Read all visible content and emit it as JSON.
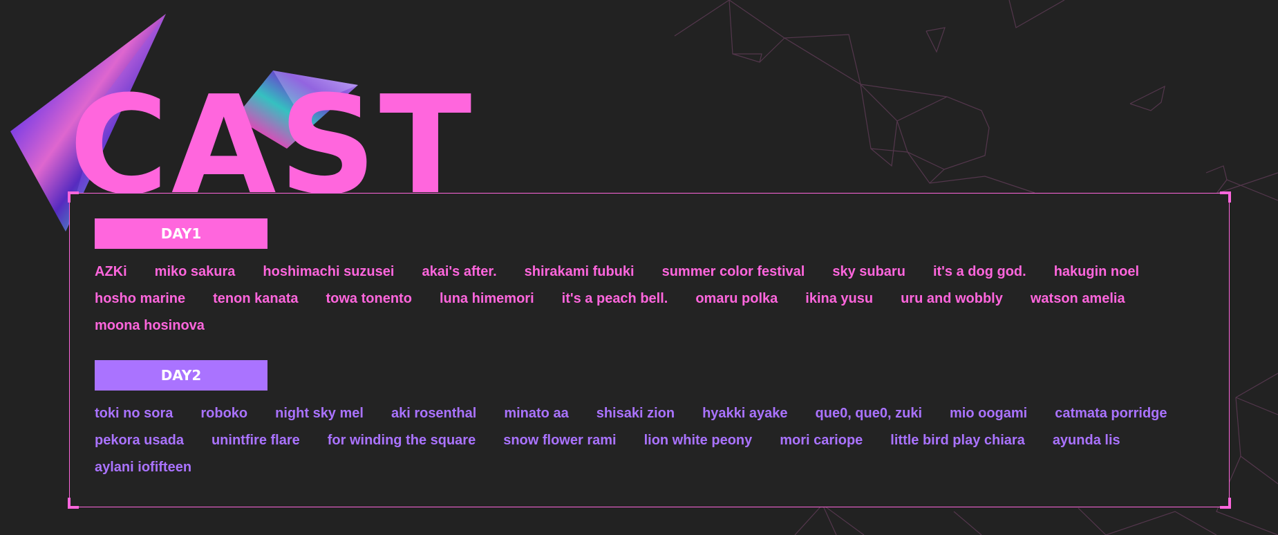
{
  "title": "CAST",
  "colors": {
    "accent_pink": "#ff66dd",
    "accent_purple": "#aa73ff",
    "background": "#222222"
  },
  "day1": {
    "label": "DAY1",
    "names": [
      "AZKi",
      "miko sakura",
      "hoshimachi suzusei",
      "akai's after.",
      "shirakami fubuki",
      "summer color festival",
      "sky subaru",
      "it's a dog god.",
      "hakugin noel",
      "hosho marine",
      "tenon kanata",
      "towa tonento",
      "luna himemori",
      "it's a peach bell.",
      "omaru polka",
      "ikina yusu",
      "uru and wobbly",
      "watson amelia",
      "moona hosinova"
    ]
  },
  "day2": {
    "label": "DAY2",
    "names": [
      "toki no sora",
      "roboko",
      "night sky mel",
      "aki rosenthal",
      "minato aa",
      "shisaki zion",
      "hyakki ayake",
      "que0, que0, zuki",
      "mio oogami",
      "catmata porridge",
      "pekora usada",
      "unintfire flare",
      "for winding the square",
      "snow flower rami",
      "lion white peony",
      "mori cariope",
      "little bird play chiara",
      "ayunda lis",
      "aylani iofifteen"
    ]
  }
}
